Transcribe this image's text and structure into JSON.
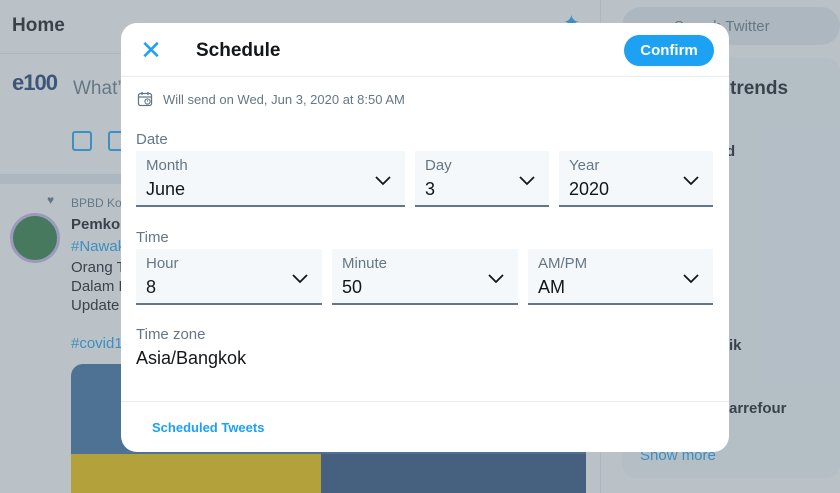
{
  "background": {
    "home_title": "Home",
    "avatar_text": "e100",
    "compose_placeholder": "What’",
    "tweet": {
      "account_fragment": "BPBD Ko",
      "name_fragment": "Pemko",
      "line1": "#Nawak",
      "line2": "Orang T",
      "line3": "Dalam P",
      "line4": "Update",
      "hashtag": "#covid1"
    },
    "search_placeholder": "Search Twitter",
    "trends_title": "trends",
    "trend_fragments": [
      "d",
      "ik",
      "arrefour"
    ],
    "show_more": "Show more"
  },
  "modal": {
    "title": "Schedule",
    "confirm_label": "Confirm",
    "will_send": "Will send on Wed, Jun 3, 2020 at 8:50 AM",
    "date_section": "Date",
    "time_section": "Time",
    "month": {
      "label": "Month",
      "value": "June"
    },
    "day": {
      "label": "Day",
      "value": "3"
    },
    "year": {
      "label": "Year",
      "value": "2020"
    },
    "hour": {
      "label": "Hour",
      "value": "8"
    },
    "minute": {
      "label": "Minute",
      "value": "50"
    },
    "ampm": {
      "label": "AM/PM",
      "value": "AM"
    },
    "timezone": {
      "label": "Time zone",
      "value": "Asia/Bangkok"
    },
    "scheduled_tweets_link": "Scheduled Tweets"
  },
  "colors": {
    "accent": "#1da1f2",
    "overlay": "rgba(101,119,134,0.45)",
    "text_secondary": "#657786"
  }
}
